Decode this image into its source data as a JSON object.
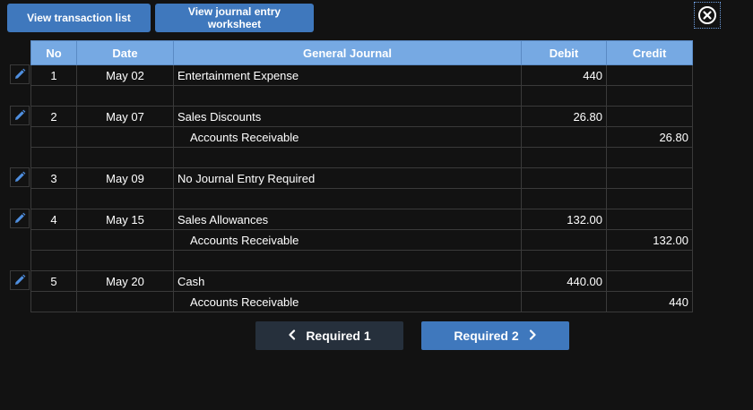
{
  "toolbar": {
    "view_transaction_list": "View transaction list",
    "view_journal_worksheet": "View journal entry worksheet"
  },
  "icons": {
    "close": "close-circle-icon",
    "edit": "pencil-icon",
    "prev": "chevron-left-icon",
    "next": "chevron-right-icon"
  },
  "colors": {
    "primary": "#3f78bd",
    "header": "#76a9e3",
    "background": "#121212",
    "dark_button": "#26303c",
    "edit_icon": "#4f8fe0"
  },
  "table": {
    "headers": {
      "no": "No",
      "date": "Date",
      "account": "General Journal",
      "debit": "Debit",
      "credit": "Credit"
    },
    "rows": [
      {
        "no": "1",
        "date": "May 02",
        "account": "Entertainment Expense",
        "debit": "440",
        "credit": "",
        "indent": false
      },
      {
        "no": "",
        "date": "",
        "account": "",
        "debit": "",
        "credit": "",
        "indent": false
      },
      {
        "no": "2",
        "date": "May 07",
        "account": "Sales Discounts",
        "debit": "26.80",
        "credit": "",
        "indent": false
      },
      {
        "no": "",
        "date": "",
        "account": "Accounts Receivable",
        "debit": "",
        "credit": "26.80",
        "indent": true
      },
      {
        "no": "",
        "date": "",
        "account": "",
        "debit": "",
        "credit": "",
        "indent": false
      },
      {
        "no": "3",
        "date": "May 09",
        "account": "No Journal Entry Required",
        "debit": "",
        "credit": "",
        "indent": false
      },
      {
        "no": "",
        "date": "",
        "account": "",
        "debit": "",
        "credit": "",
        "indent": false
      },
      {
        "no": "4",
        "date": "May 15",
        "account": "Sales Allowances",
        "debit": "132.00",
        "credit": "",
        "indent": false
      },
      {
        "no": "",
        "date": "",
        "account": "Accounts Receivable",
        "debit": "",
        "credit": "132.00",
        "indent": true
      },
      {
        "no": "",
        "date": "",
        "account": "",
        "debit": "",
        "credit": "",
        "indent": false
      },
      {
        "no": "5",
        "date": "May 20",
        "account": "Cash",
        "debit": "440.00",
        "credit": "",
        "indent": false
      },
      {
        "no": "",
        "date": "",
        "account": "Accounts Receivable",
        "debit": "",
        "credit": "440",
        "indent": true
      }
    ]
  },
  "nav": {
    "prev_label": "Required 1",
    "next_label": "Required 2"
  }
}
